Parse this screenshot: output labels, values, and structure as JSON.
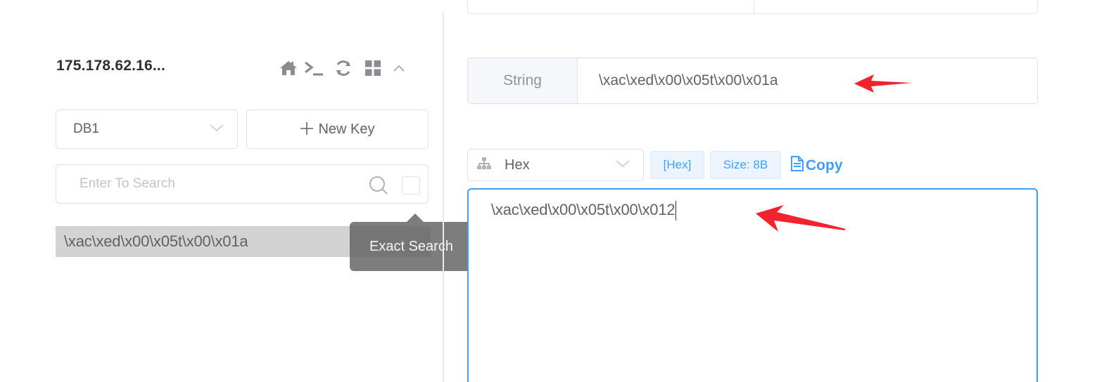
{
  "sidebar": {
    "server_title": "175.178.62.16...",
    "header_icons": [
      "home-icon",
      "terminal-icon",
      "refresh-icon",
      "grid-icon",
      "collapse-chevron-icon"
    ],
    "db_select": {
      "value": "DB1"
    },
    "new_key_button": {
      "label": "New Key",
      "icon": "plus-icon"
    },
    "search": {
      "placeholder": "Enter To Search",
      "value": ""
    },
    "exact_search_tooltip": "Exact Search",
    "keys": [
      {
        "name": "\\xac\\xed\\x00\\x05t\\x00\\x01a"
      }
    ]
  },
  "detail": {
    "key_type": "String",
    "key_name": "\\xac\\xed\\x00\\x05t\\x00\\x01a",
    "format_select": {
      "value": "Hex",
      "icon": "sitemap-icon"
    },
    "format_tag": "[Hex]",
    "size_tag": "Size: 8B",
    "copy_label": "Copy",
    "value_text": "\\xac\\xed\\x00\\x05t\\x00\\x012"
  },
  "annotations": {
    "arrow_color": "#f5222d",
    "arrows": [
      "points-to-key-name",
      "points-to-value-text"
    ]
  },
  "colors": {
    "accent": "#409eff",
    "selected_key_bg": "#d3d3d3",
    "tooltip_bg": "#606060"
  }
}
